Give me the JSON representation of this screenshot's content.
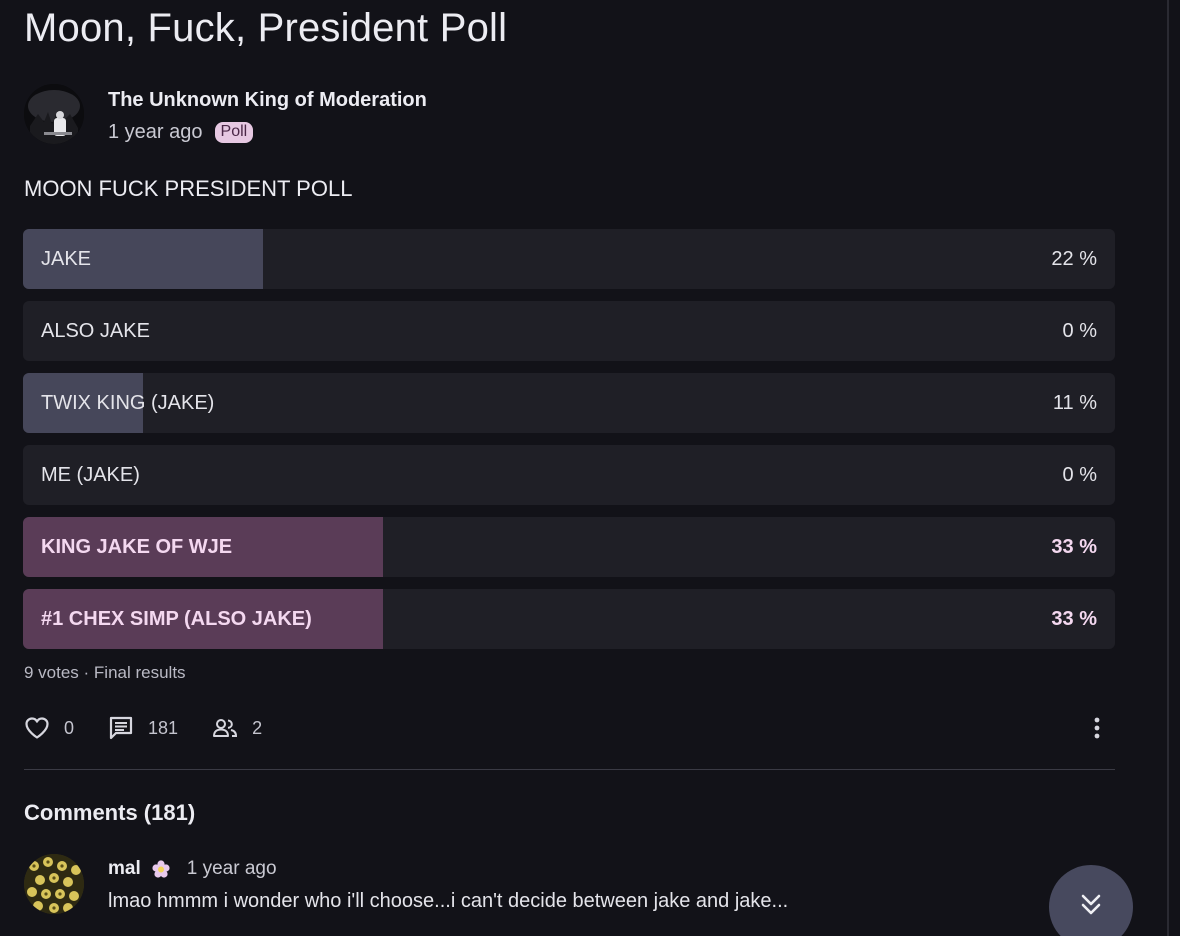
{
  "post": {
    "title": "Moon, Fuck, President Poll",
    "author": "The Unknown King of Moderation",
    "time": "1 year ago",
    "badge": "Poll",
    "question": "MOON FUCK PRESIDENT POLL"
  },
  "poll": {
    "options": [
      {
        "label": "JAKE",
        "percent_text": "22 %",
        "percent": 22,
        "winner": false
      },
      {
        "label": "ALSO JAKE",
        "percent_text": "0 %",
        "percent": 0,
        "winner": false
      },
      {
        "label": "TWIX KING (JAKE)",
        "percent_text": "11 %",
        "percent": 11,
        "winner": false
      },
      {
        "label": "ME (JAKE)",
        "percent_text": "0 %",
        "percent": 0,
        "winner": false
      },
      {
        "label": "KING JAKE OF WJE",
        "percent_text": "33 %",
        "percent": 33,
        "winner": true
      },
      {
        "label": "#1 CHEX SIMP (ALSO JAKE)",
        "percent_text": "33 %",
        "percent": 33,
        "winner": true
      }
    ],
    "summary": "9 votes · Final results"
  },
  "actions": {
    "likes": "0",
    "comments": "181",
    "participants": "2"
  },
  "comments": {
    "heading": "Comments (181)",
    "items": [
      {
        "author": "mal",
        "badge_icon": "flower-icon",
        "time": "1 year ago",
        "text": "lmao hmmm i wonder who i'll choose...i can't decide between jake and jake..."
      }
    ]
  },
  "icons": {
    "like": "heart-outline-icon",
    "comments": "comment-icon",
    "participants": "people-icon",
    "more": "more-vertical-icon",
    "scroll": "double-chevron-down-icon"
  },
  "colors": {
    "background": "#121218",
    "option_bg": "#1f1f26",
    "option_fill": "#46475a",
    "winner_fill": "#5a3c57",
    "winner_text": "#f4d8f0",
    "badge_bg": "#e6c8e2"
  }
}
